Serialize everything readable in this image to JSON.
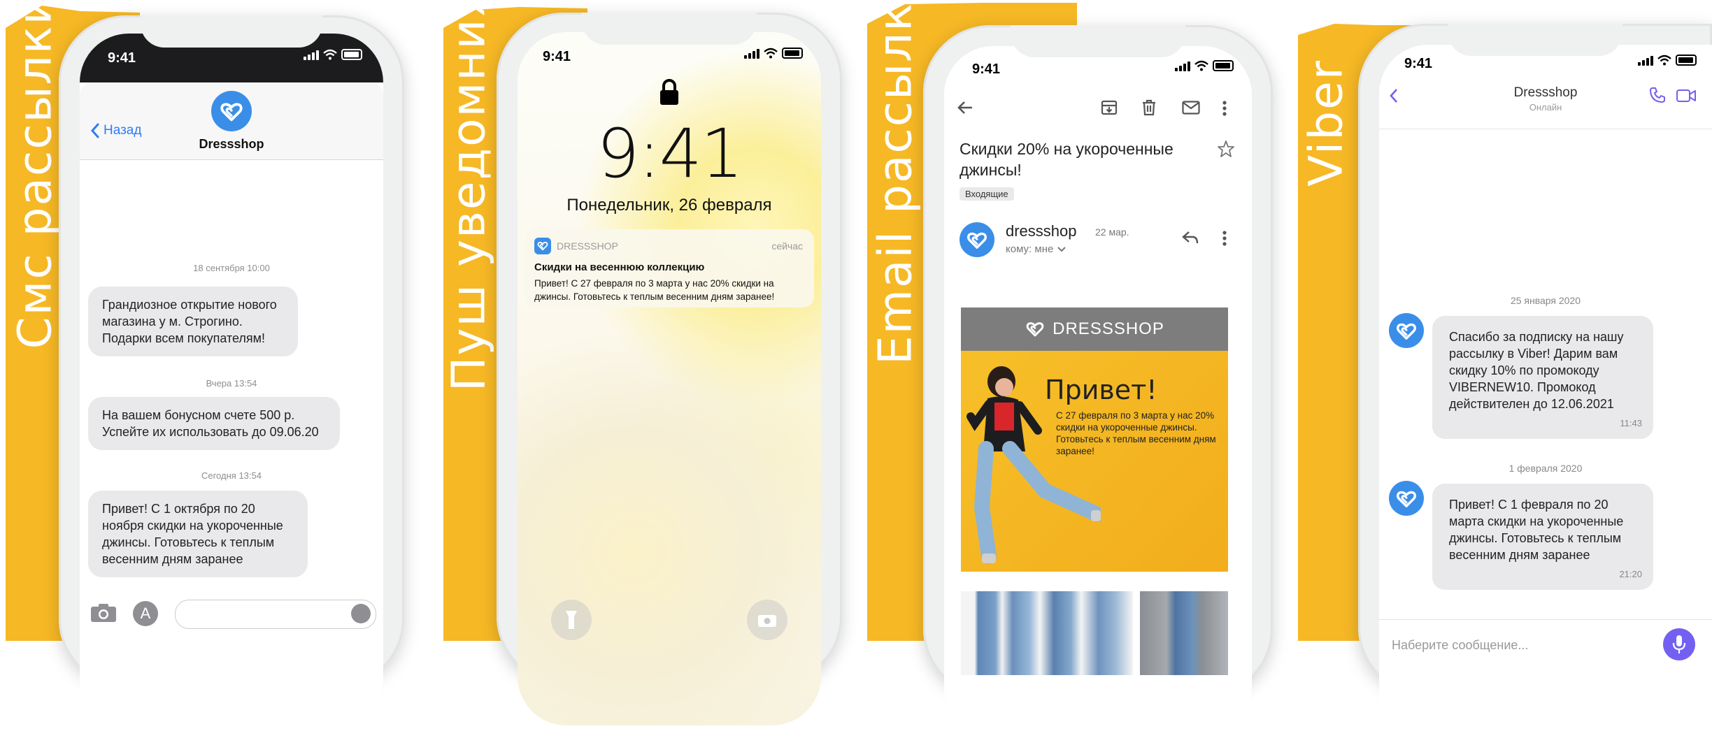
{
  "colors": {
    "accent_yellow": "#f6b825",
    "brand_blue": "#3a8ee8",
    "ios_blue": "#2e7cf6",
    "viber_purple": "#7360f2",
    "bubble_gray": "#e9e9eb"
  },
  "sms": {
    "side_label": "Смс рассылки",
    "status_time": "9:41",
    "back_label": "Назад",
    "contact": "Dressshop",
    "messages": [
      {
        "date": "18 сентября 10:00",
        "text": "Грандиозное открытие нового магазина у м. Строгино. Подарки всем покупателям!"
      },
      {
        "date": "Вчера 13:54",
        "text": "На вашем бонусном счете 500 р. Успейте их использовать до 09.06.20"
      },
      {
        "date": "Сегодня 13:54",
        "text": "Привет! С 1 октября по 20 ноября скидки на укороченные джинсы. Готовьтесь к теплым весенним дням заранее"
      }
    ]
  },
  "push": {
    "side_label": "Пуш уведомния",
    "status_time": "9:41",
    "clock": "9:41",
    "date": "Понедельник, 26 февраля",
    "notification": {
      "app": "DRESSSHOP",
      "time": "сейчас",
      "title": "Скидки на весеннюю коллекцию",
      "body": "Привет! С 27 февраля по 3 марта у нас 20% скидки на джинсы. Готовьтесь к теплым весенним дням заранее!"
    },
    "icons": [
      "lock-icon",
      "flashlight-icon",
      "camera-icon"
    ]
  },
  "email": {
    "side_label": "Email рассылки",
    "status_time": "9:41",
    "subject": "Скидки 20% на укороченные джинсы!",
    "label": "Входящие",
    "sender": "dressshop",
    "date": "22 мар.",
    "to": "кому: мне",
    "banner_brand": "DRESSSHOP",
    "banner_title": "Привет!",
    "banner_text": "С 27 февраля по 3 марта у нас 20% скидки на укороченные джинсы. Готовьтесь к теплым весенним дням заранее!"
  },
  "viber": {
    "side_label": "Viber",
    "status_time": "9:41",
    "contact": "Dressshop",
    "status": "Онлайн",
    "messages": [
      {
        "date": "25 января 2020",
        "text": "Спасибо за подписку на нашу рассылку в Viber! Дарим вам скидку 10% по промокоду VIBERNEW10. Промокод действителен до 12.06.2021",
        "time": "11:43"
      },
      {
        "date": "1 февраля 2020",
        "text": "Привет! С 1 февраля по 20 марта скидки на укороченные джинсы. Готовьтесь к теплым весенним дням заранее",
        "time": "21:20"
      }
    ],
    "input_placeholder": "Наберите сообщение..."
  }
}
